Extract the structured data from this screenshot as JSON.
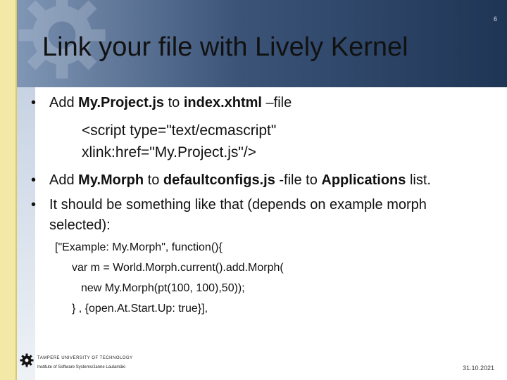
{
  "slide": {
    "number": "6",
    "title": "Link your file with Lively Kernel",
    "date": "31.10.2021"
  },
  "bullets": {
    "b1": {
      "pre": "Add ",
      "file1": "My.Project.js",
      "mid": " to ",
      "file2": "index.xhtml",
      "post": " –file"
    },
    "script_line1": "<script type=\"text/ecmascript\"",
    "script_line2": "xlink:href=\"My.Project.js\"/>",
    "b2": {
      "pre": "Add ",
      "morph": "My.Morph",
      "mid": " to ",
      "file": "defaultconfigs.js",
      "mid2": " -file to ",
      "list": "Applications",
      "post": " list."
    },
    "b3": "It should be something like that (depends on example morph selected):",
    "code": [
      "[\"Example: My.Morph\", function(){",
      "var m = World.Morph.current().add.Morph(",
      "new My.Morph(pt(100, 100),50));",
      "} , {open.At.Start.Up: true}],"
    ]
  },
  "footer": {
    "university": "TAMPERE UNIVERSITY OF TECHNOLOGY",
    "institute": "Institute of Software Systems/Janne Lautamäki"
  },
  "colors": {
    "header_dark": "#1f3556",
    "header_light": "#8096b5",
    "stripe": "#f2e9a6"
  }
}
